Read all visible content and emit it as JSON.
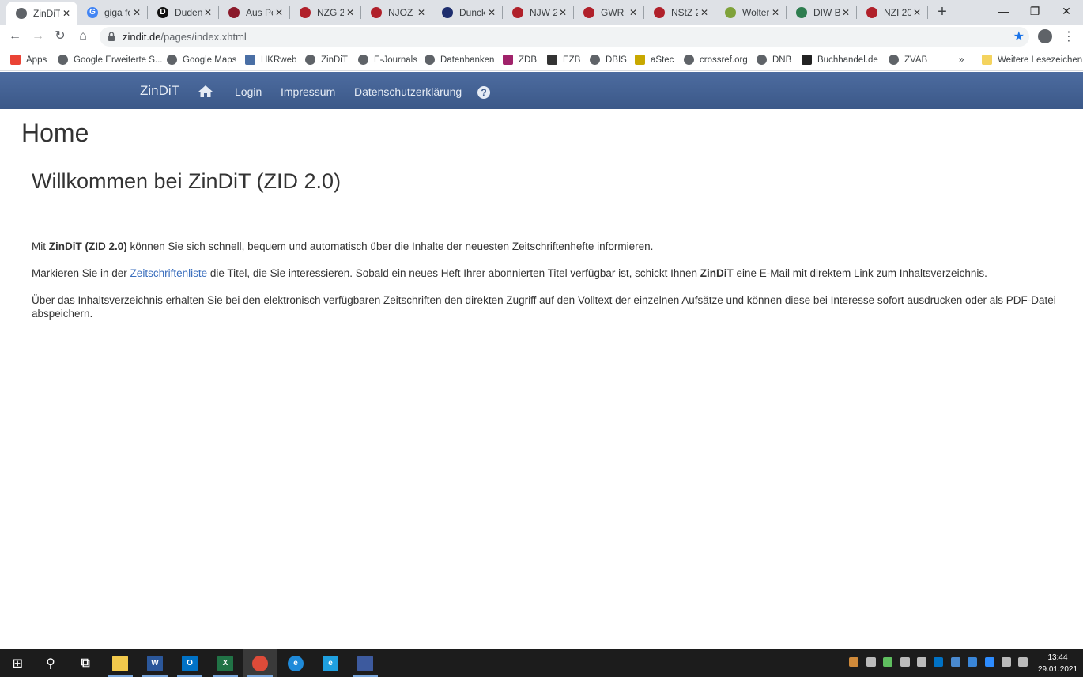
{
  "browser": {
    "tabs": [
      {
        "title": "ZinDiT",
        "favicon_text": "",
        "favicon_color": "#5f6368",
        "active": true
      },
      {
        "title": "giga fo",
        "favicon_text": "G",
        "favicon_color": "#4285f4"
      },
      {
        "title": "Duden",
        "favicon_text": "D",
        "favicon_color": "#111111"
      },
      {
        "title": "Aus Po",
        "favicon_text": "",
        "favicon_color": "#8b1a2b"
      },
      {
        "title": "NZG 2",
        "favicon_text": "",
        "favicon_color": "#b0202a"
      },
      {
        "title": "NJOZ 2",
        "favicon_text": "",
        "favicon_color": "#b0202a"
      },
      {
        "title": "Duncki",
        "favicon_text": "",
        "favicon_color": "#1e2e6e"
      },
      {
        "title": "NJW 2",
        "favicon_text": "",
        "favicon_color": "#b0202a"
      },
      {
        "title": "GWR 2",
        "favicon_text": "",
        "favicon_color": "#b0202a"
      },
      {
        "title": "NStZ 2",
        "favicon_text": "",
        "favicon_color": "#b0202a"
      },
      {
        "title": "Wolter",
        "favicon_text": "",
        "favicon_color": "#7fa23a"
      },
      {
        "title": "DIW B",
        "favicon_text": "",
        "favicon_color": "#2e7d4f"
      },
      {
        "title": "NZI 20",
        "favicon_text": "",
        "favicon_color": "#b0202a"
      }
    ],
    "new_tab_label": "+",
    "window_controls": {
      "minimize": "—",
      "restore": "❐",
      "close": "✕"
    },
    "nav": {
      "back": "←",
      "forward": "→",
      "reload": "↻",
      "home": "⌂"
    },
    "address": {
      "host": "zindit.de",
      "path": "/pages/index.xhtml"
    },
    "star": "★",
    "menu": "⋮",
    "bookmarks": [
      {
        "label": "Apps",
        "icon": "apps-icon",
        "color": "#ea4335"
      },
      {
        "label": "Google Erweiterte S...",
        "icon": "globe-icon",
        "color": "#5f6368"
      },
      {
        "label": "Google Maps",
        "icon": "globe-icon",
        "color": "#5f6368"
      },
      {
        "label": "HKRweb",
        "icon": "hkrweb-icon",
        "color": "#4a6fa5"
      },
      {
        "label": "ZinDiT",
        "icon": "globe-icon",
        "color": "#5f6368"
      },
      {
        "label": "E-Journals",
        "icon": "globe-icon",
        "color": "#5f6368"
      },
      {
        "label": "Datenbanken",
        "icon": "globe-icon",
        "color": "#5f6368"
      },
      {
        "label": "ZDB",
        "icon": "zdb-icon",
        "color": "#a0226a"
      },
      {
        "label": "EZB",
        "icon": "ezb-icon",
        "color": "#333333"
      },
      {
        "label": "DBIS",
        "icon": "globe-icon",
        "color": "#5f6368"
      },
      {
        "label": "aStec",
        "icon": "astec-icon",
        "color": "#c8a800"
      },
      {
        "label": "crossref.org",
        "icon": "globe-icon",
        "color": "#5f6368"
      },
      {
        "label": "DNB",
        "icon": "globe-icon",
        "color": "#5f6368"
      },
      {
        "label": "Buchhandel.de",
        "icon": "buchhandel-icon",
        "color": "#222222"
      },
      {
        "label": "ZVAB",
        "icon": "globe-icon",
        "color": "#5f6368"
      }
    ],
    "bookmarks_overflow": "»",
    "other_bookmarks": "Weitere Lesezeichen"
  },
  "site": {
    "brand": "ZinDiT",
    "nav": {
      "login": "Login",
      "impressum": "Impressum",
      "privacy": "Datenschutzerklärung",
      "help": "?"
    },
    "page_title": "Home",
    "welcome": "Willkommen bei ZinDiT (ZID 2.0)",
    "p1": {
      "pre": "Mit ",
      "bold": "ZinDiT (ZID 2.0)",
      "post": " können Sie sich schnell, bequem und automatisch über die Inhalte der neuesten Zeitschriftenhefte informieren."
    },
    "p2": {
      "pre": "Markieren Sie in der ",
      "link": "Zeitschriftenliste",
      "mid": " die Titel, die Sie interessieren. Sobald ein neues Heft Ihrer abonnierten Titel verfügbar ist, schickt Ihnen ",
      "bold": "ZinDiT",
      "post": " eine E-Mail mit direktem Link zum Inhaltsverzeichnis."
    },
    "p3": "Über das Inhaltsverzeichnis erhalten Sie bei den elektronisch verfügbaren Zeitschriften den direkten Zugriff auf den Volltext der einzelnen Aufsätze und können diese bei Interesse sofort ausdrucken oder als PDF-Datei abspeichern."
  },
  "taskbar": {
    "apps": [
      {
        "name": "start-button",
        "glyph": "⊞",
        "color": "#ffffff"
      },
      {
        "name": "search-button",
        "glyph": "⚲",
        "color": "#ffffff"
      },
      {
        "name": "task-view-button",
        "glyph": "⧉",
        "color": "#ffffff"
      },
      {
        "name": "explorer-app",
        "glyph": "",
        "color": "#f2c94c",
        "running": true
      },
      {
        "name": "word-app",
        "glyph": "W",
        "color": "#2b579a",
        "running": true
      },
      {
        "name": "outlook-app",
        "glyph": "O",
        "color": "#0072c6",
        "running": true
      },
      {
        "name": "excel-app",
        "glyph": "X",
        "color": "#217346",
        "running": true
      },
      {
        "name": "chrome-app",
        "glyph": "",
        "color": "#dd4b39",
        "running": true,
        "active": true
      },
      {
        "name": "edge-app",
        "glyph": "e",
        "color": "#1f8ad9"
      },
      {
        "name": "ie-app",
        "glyph": "e",
        "color": "#1fa0e0"
      },
      {
        "name": "other-app",
        "glyph": "",
        "color": "#3d5a9e",
        "running": true
      }
    ],
    "time": "13:44",
    "date": "29.01.2021"
  }
}
